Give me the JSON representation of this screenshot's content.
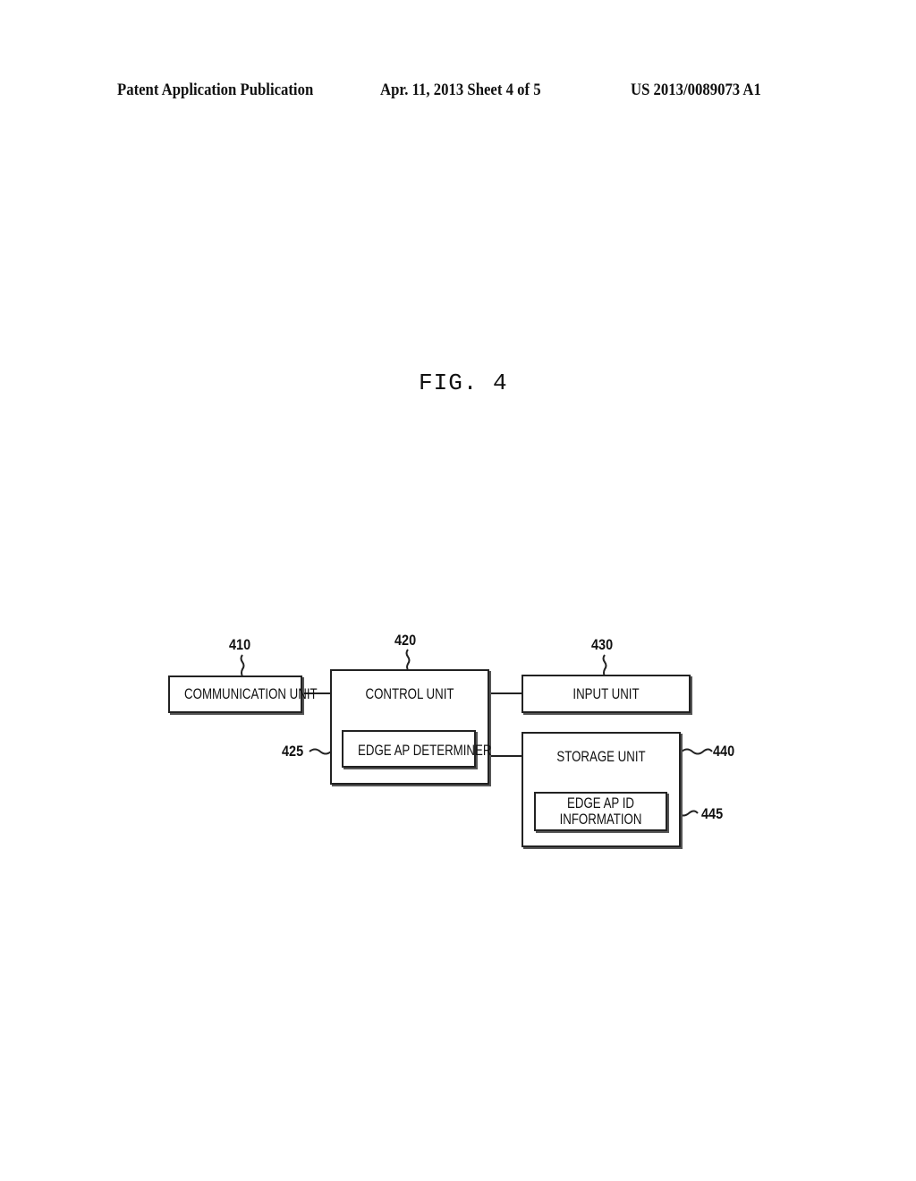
{
  "header": {
    "left": "Patent Application Publication",
    "center": "Apr. 11, 2013  Sheet 4 of 5",
    "right": "US 2013/0089073 A1"
  },
  "figure": {
    "title": "FIG. 4"
  },
  "diagram": {
    "blocks": {
      "communication_unit": {
        "ref": "410",
        "label": "COMMUNICATION UNIT"
      },
      "control_unit": {
        "ref": "420",
        "label": "CONTROL UNIT"
      },
      "edge_ap_determiner": {
        "ref": "425",
        "label": "EDGE AP DETERMINER"
      },
      "input_unit": {
        "ref": "430",
        "label": "INPUT UNIT"
      },
      "storage_unit": {
        "ref": "440",
        "label": "STORAGE UNIT"
      },
      "edge_ap_id_information": {
        "ref": "445",
        "label_line1": "EDGE AP ID",
        "label_line2": "INFORMATION"
      }
    },
    "connections": [
      [
        "communication_unit",
        "control_unit"
      ],
      [
        "control_unit",
        "input_unit"
      ],
      [
        "control_unit",
        "storage_unit"
      ]
    ]
  }
}
